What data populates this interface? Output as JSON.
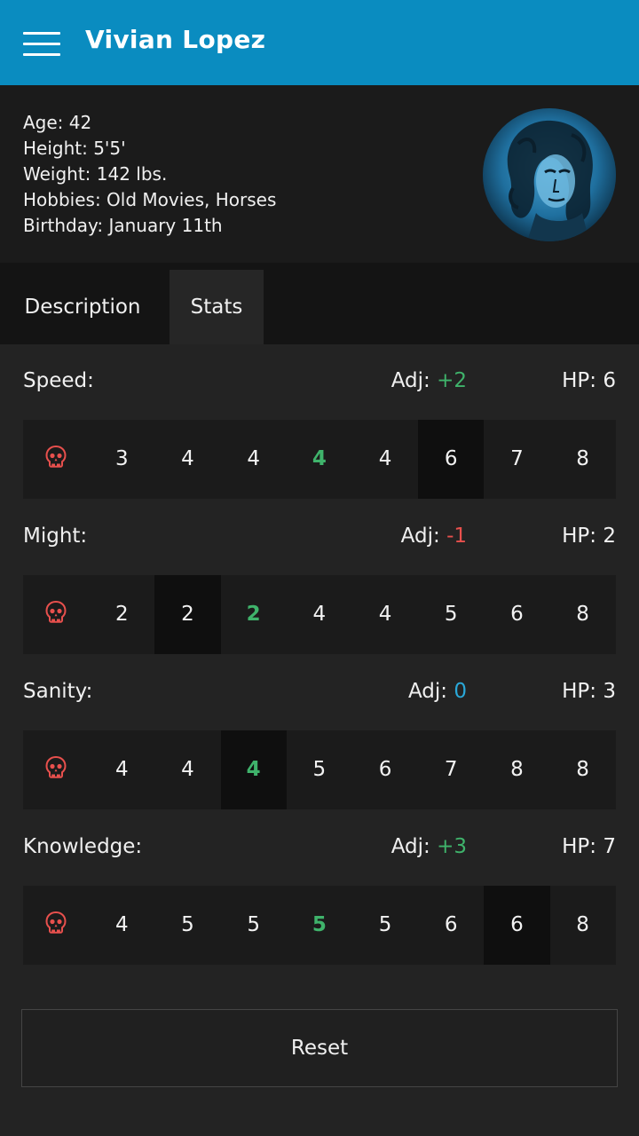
{
  "header": {
    "title": "Vivian Lopez",
    "bg_color": "#0a8cc0"
  },
  "profile": {
    "age": "Age: 42",
    "height": "Height: 5'5'",
    "weight": "Weight: 142 lbs.",
    "hobbies": "Hobbies: Old Movies, Horses",
    "birthday": "Birthday: January 11th",
    "avatar_icon": "character-portrait"
  },
  "tabs": [
    {
      "label": "Description",
      "active": false
    },
    {
      "label": "Stats",
      "active": true
    }
  ],
  "colors": {
    "positive": "#3fb36b",
    "negative": "#e8504d",
    "neutral": "#2aa8d8",
    "skull": "#e8504d"
  },
  "stats": [
    {
      "name": "Speed:",
      "adj_label": "Adj:",
      "adj_value": "+2",
      "adj_tone": "positive",
      "hp": "HP: 6",
      "death_icon": "skull-icon",
      "values": [
        "3",
        "4",
        "4",
        "4",
        "4",
        "6",
        "7",
        "8"
      ],
      "base_index": 3,
      "selected_index": 5
    },
    {
      "name": "Might:",
      "adj_label": "Adj:",
      "adj_value": "-1",
      "adj_tone": "negative",
      "hp": "HP: 2",
      "death_icon": "skull-icon",
      "values": [
        "2",
        "2",
        "2",
        "4",
        "4",
        "5",
        "6",
        "8"
      ],
      "base_index": 2,
      "selected_index": 1
    },
    {
      "name": "Sanity:",
      "adj_label": "Adj:",
      "adj_value": "0",
      "adj_tone": "neutral",
      "hp": "HP: 3",
      "death_icon": "skull-icon",
      "values": [
        "4",
        "4",
        "4",
        "5",
        "6",
        "7",
        "8",
        "8"
      ],
      "base_index": 2,
      "selected_index": 2
    },
    {
      "name": "Knowledge:",
      "adj_label": "Adj:",
      "adj_value": "+3",
      "adj_tone": "positive",
      "hp": "HP: 7",
      "death_icon": "skull-icon",
      "values": [
        "4",
        "5",
        "5",
        "5",
        "5",
        "6",
        "6",
        "8"
      ],
      "base_index": 3,
      "selected_index": 6
    }
  ],
  "reset_label": "Reset"
}
